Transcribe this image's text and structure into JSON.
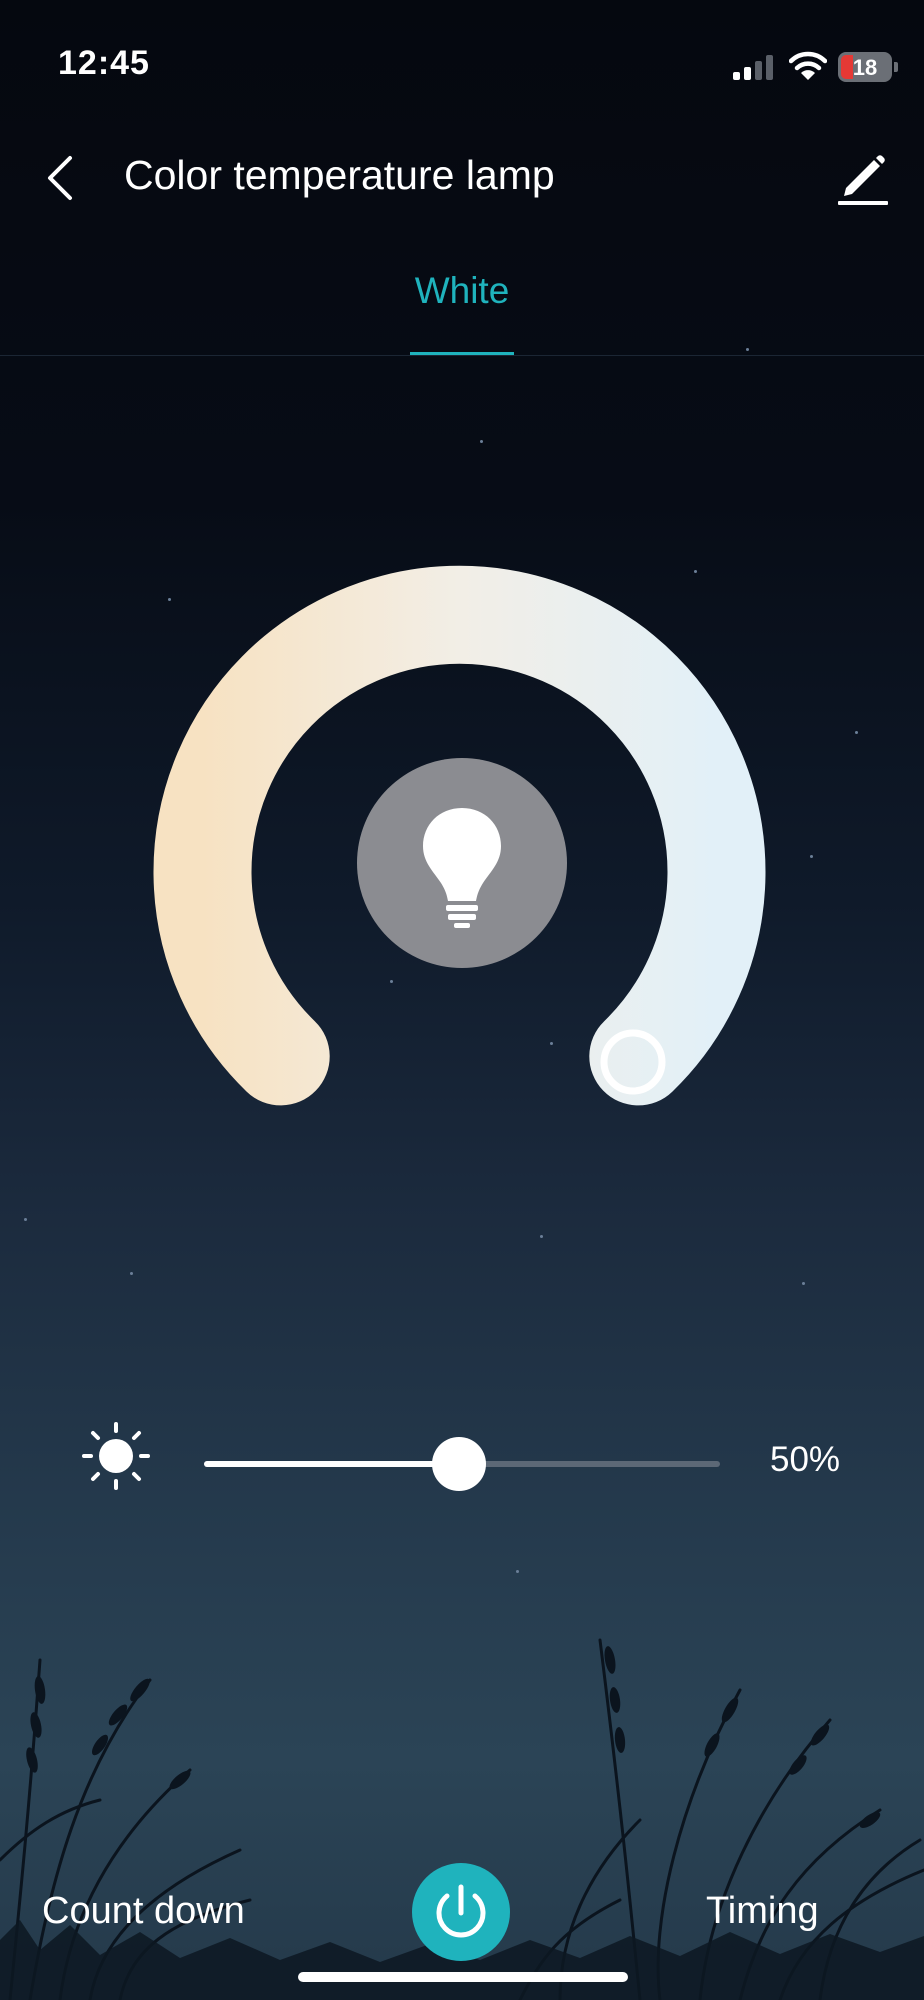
{
  "status_bar": {
    "time": "12:45",
    "battery_level": "18"
  },
  "header": {
    "title": "Color temperature lamp",
    "back_icon": "chevron-left-icon",
    "edit_icon": "pencil-icon"
  },
  "tabs": [
    {
      "label": "White",
      "active": true
    }
  ],
  "color_temperature": {
    "warm_color": "#f6e3c4",
    "cool_color": "#e3f1f8",
    "selected_position": "cool-end"
  },
  "brightness": {
    "icon": "sun-icon",
    "value_percent": 50,
    "label": "50%"
  },
  "footer": {
    "count_down_label": "Count down",
    "timing_label": "Timing",
    "power_icon": "power-icon"
  },
  "colors": {
    "accent": "#1fb3bd",
    "background_top": "#05080f",
    "background_bottom": "#2b4456"
  }
}
